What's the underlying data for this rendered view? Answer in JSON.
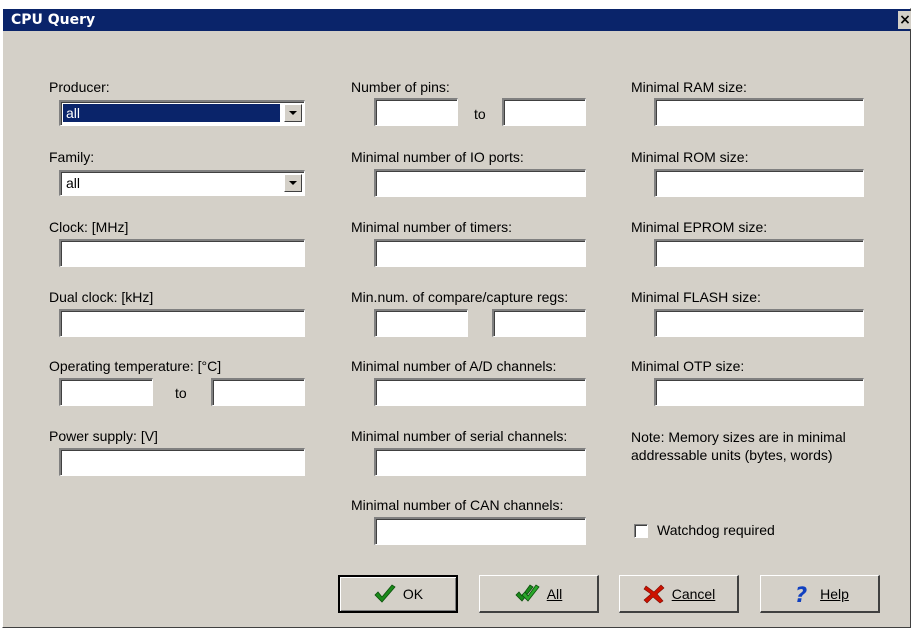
{
  "window": {
    "title": "CPU Query",
    "close_glyph": "×"
  },
  "col1": {
    "producer_label": "Producer:",
    "producer_value": "all",
    "family_label": "Family:",
    "family_value": "all",
    "clock_label": "Clock: [MHz]",
    "clock_value": "",
    "dual_clock_label": "Dual clock: [kHz]",
    "dual_clock_value": "",
    "temp_label": "Operating temperature: [°C]",
    "temp_from": "",
    "temp_to_label": "to",
    "temp_to": "",
    "power_label": "Power supply: [V]",
    "power_value": ""
  },
  "col2": {
    "pins_label": "Number of pins:",
    "pins_from": "",
    "pins_to_label": "to",
    "pins_to": "",
    "io_label": "Minimal number of IO ports:",
    "io_value": "",
    "timers_label": "Minimal number of timers:",
    "timers_value": "",
    "compare_label": "Min.num. of compare/capture regs:",
    "compare_value1": "",
    "compare_value2": "",
    "ad_label": "Minimal number of A/D channels:",
    "ad_value": "",
    "serial_label": "Minimal number of serial channels:",
    "serial_value": "",
    "can_label": "Minimal number of CAN channels:",
    "can_value": ""
  },
  "col3": {
    "ram_label": "Minimal RAM size:",
    "ram_value": "",
    "rom_label": "Minimal ROM size:",
    "rom_value": "",
    "eprom_label": "Minimal EPROM size:",
    "eprom_value": "",
    "flash_label": "Minimal FLASH size:",
    "flash_value": "",
    "otp_label": "Minimal OTP size:",
    "otp_value": "",
    "note_line1": "Note: Memory sizes are in minimal",
    "note_line2": "addressable units (bytes, words)",
    "watchdog_label": "Watchdog required",
    "watchdog_checked": false
  },
  "buttons": {
    "ok_label": "OK",
    "all_label": "All",
    "cancel_label": "Cancel",
    "help_label": "Help"
  },
  "colors": {
    "title_bar": "#0a246a",
    "face": "#d4d0c8",
    "ok_icon": "#1a8a1a",
    "cancel_icon": "#cc1100",
    "help_icon": "#1040c0"
  },
  "icons": {
    "ok": "checkmark-icon",
    "all": "double-checkmark-icon",
    "cancel": "red-x-icon",
    "help": "question-mark-icon"
  }
}
